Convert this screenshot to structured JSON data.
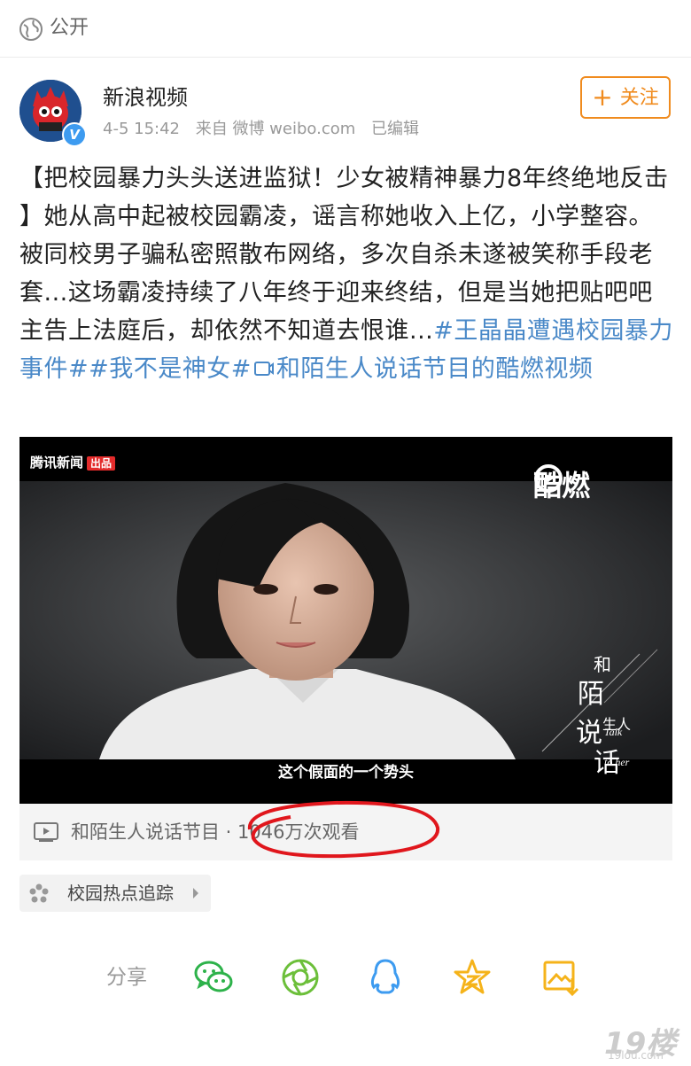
{
  "header": {
    "visibility_label": "公开"
  },
  "post": {
    "author": "新浪视频",
    "time": "4-5 15:42",
    "source": "来自 微博 weibo.com",
    "edited": "已编辑",
    "follow_label": "关注",
    "text_main": "【把校园暴力头头送进监狱！少女被精神暴力8年终绝地反击 】她从高中起被校园霸凌，谣言称她收入上亿，小学整容。被同校男子骗私密照散布网络，多次自杀未遂被笑称手段老套...这场霸凌持续了八年终于迎来终结，但是当她把贴吧吧主告上法庭后，却依然不知道去恨谁...",
    "hashtag1": "#王晶晶遭遇校园暴力事件#",
    "hashtag2": "#我不是神女#",
    "video_link_text": "和陌生人说话节目的酷燃视频"
  },
  "video": {
    "source_watermark": "腾讯新闻",
    "source_badge": "出品",
    "brand": "酷燃",
    "subtitle": "这个假面的一个势头",
    "title_chars": [
      "和",
      "陌",
      "生人",
      "说",
      "话"
    ],
    "title_en": "Talk to her"
  },
  "video_bar": {
    "text": "和陌生人说话节目 · 1046万次观看"
  },
  "topic": {
    "label": "校园热点追踪"
  },
  "share": {
    "label": "分享",
    "icons": [
      "wechat-icon",
      "moments-icon",
      "qq-icon",
      "qzone-icon",
      "save-image-icon"
    ]
  },
  "watermark": {
    "main": "19楼",
    "sub": "19lou.com"
  },
  "colors": {
    "accent": "#f08b1e",
    "link": "#4a89c8",
    "share_green": "#2db24a",
    "share_blue": "#3d9bf0",
    "share_yellow": "#f5b31a",
    "annotation": "#e0161c"
  }
}
